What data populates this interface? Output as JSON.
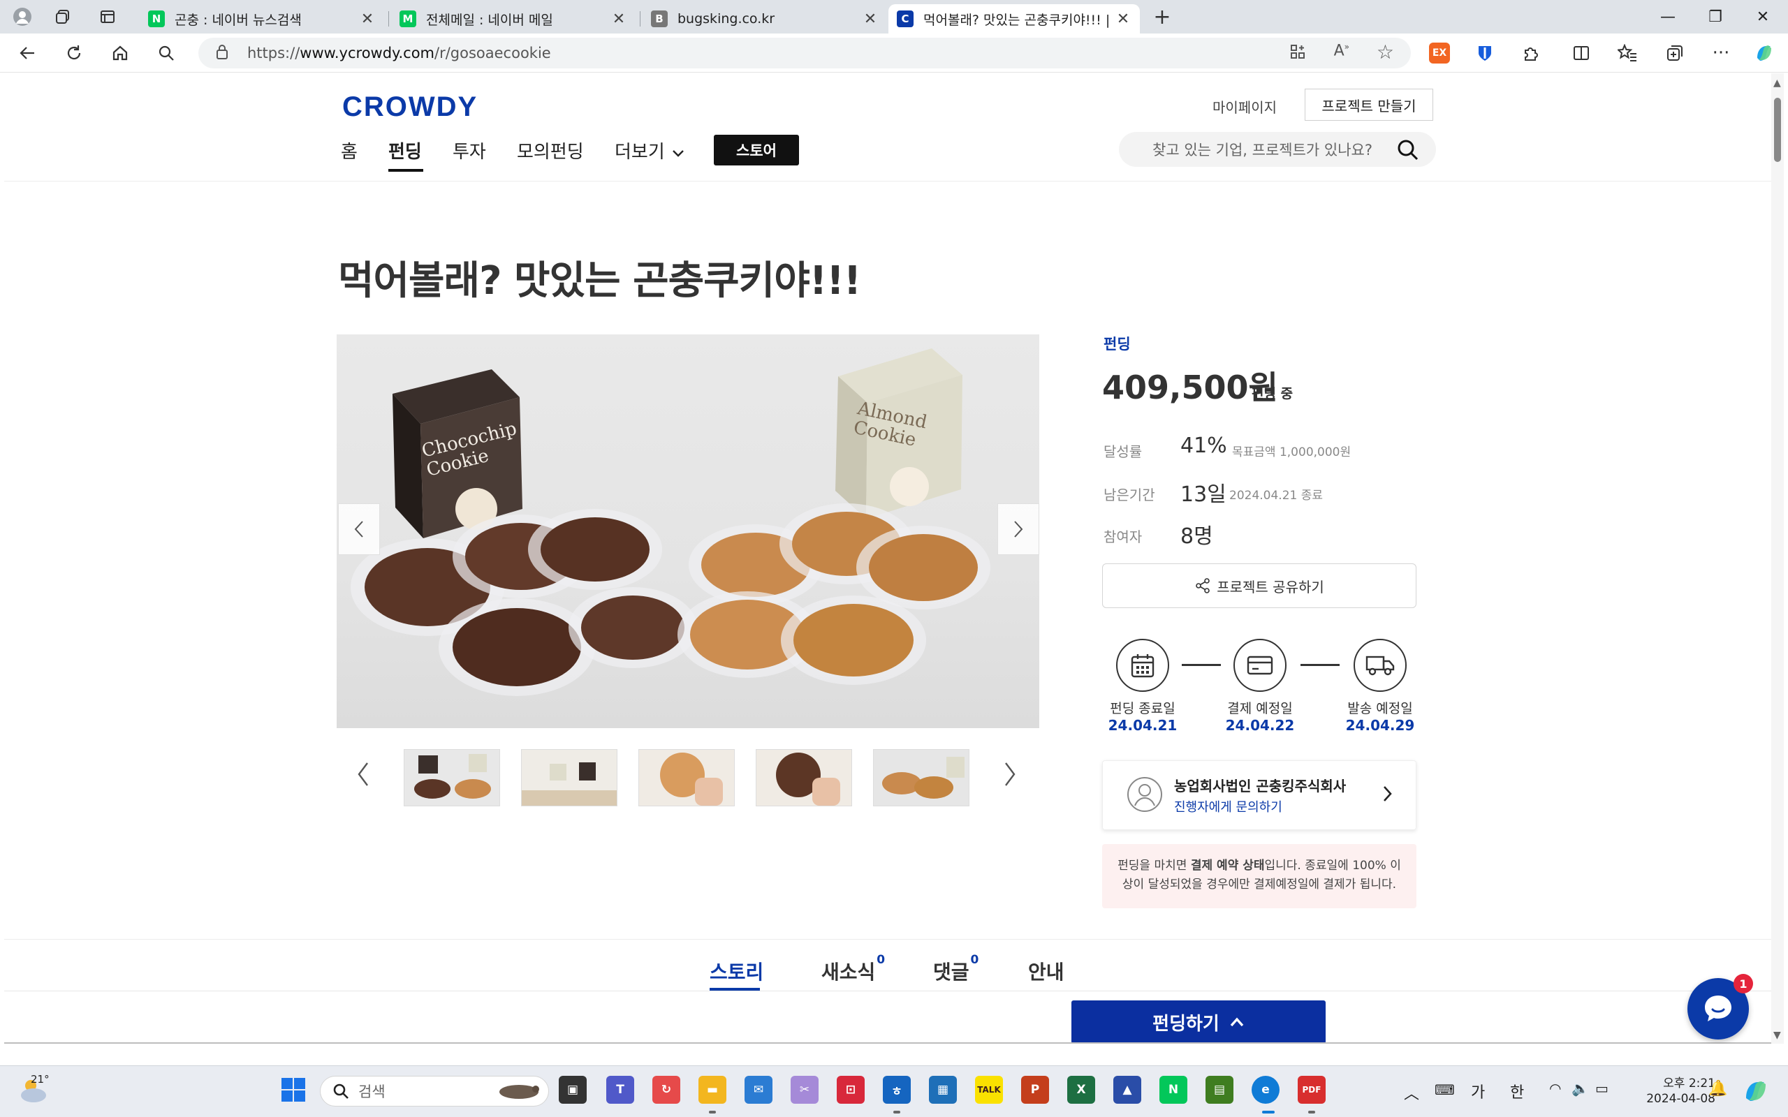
{
  "browser": {
    "tabs": [
      {
        "title": "곤충 : 네이버 뉴스검색",
        "favicon": "N",
        "color": "#03c75a"
      },
      {
        "title": "전체메일 : 네이버 메일",
        "favicon": "M",
        "color": "#03c75a"
      },
      {
        "title": "bugsking.co.kr",
        "favicon": "B",
        "color": "#777777"
      },
      {
        "title": "먹어볼래? 맛있는 곤충쿠키야!!! |",
        "favicon": "C",
        "color": "#0b3aa8"
      }
    ],
    "url_prefix": "https://",
    "url_host": "www.ycrowdy.com",
    "url_path": "/r/gosoaecookie",
    "extension_label": "EX"
  },
  "site": {
    "logo": "CROWDY",
    "mypage": "마이페이지",
    "make_project": "프로젝트 만들기",
    "nav": [
      "홈",
      "펀딩",
      "투자",
      "모의펀딩",
      "더보기"
    ],
    "store": "스토어",
    "search_placeholder": "찾고 있는 기업, 프로젝트가 있나요?"
  },
  "project": {
    "title": "먹어볼래? 맛있는 곤충쿠키야!!!",
    "category": "펀딩",
    "amount": "409,500원",
    "status": "펀딩 중",
    "rate_label": "달성률",
    "rate_value": "41%",
    "goal_text": "목표금액 1,000,000원",
    "remaining_label": "남은기간",
    "remaining_value": "13일",
    "end_text": "2024.04.21 종료",
    "participants_label": "참여자",
    "participants_value": "8명",
    "share": "프로젝트 공유하기",
    "image_box_texts": [
      "Chocochip Cookie",
      "Almond Cookie"
    ],
    "steps": [
      {
        "label": "펀딩 종료일",
        "date": "24.04.21",
        "icon": "calendar-icon"
      },
      {
        "label": "결제 예정일",
        "date": "24.04.22",
        "icon": "card-icon"
      },
      {
        "label": "발송 예정일",
        "date": "24.04.29",
        "icon": "truck-icon"
      }
    ],
    "maker_name": "농업회사법인 곤충킹주식회사",
    "maker_contact": "진행자에게 문의하기",
    "notice_pre": "펀딩을 마치면 ",
    "notice_bold": "결제 예약 상태",
    "notice_post": "입니다. 종료일에 100% 이상이 달성되었을 경우에만 결제예정일에 결제가 됩니다."
  },
  "content_tabs": [
    {
      "label": "스토리",
      "count": ""
    },
    {
      "label": "새소식",
      "count": "0"
    },
    {
      "label": "댓글",
      "count": "0"
    },
    {
      "label": "안내",
      "count": ""
    }
  ],
  "fund_button": "펀딩하기",
  "chat_badge": "1",
  "taskbar": {
    "weather": "21°",
    "search_placeholder": "검색",
    "ime1": "가",
    "ime2": "한",
    "time": "오후 2:21",
    "date": "2024-04-08"
  }
}
